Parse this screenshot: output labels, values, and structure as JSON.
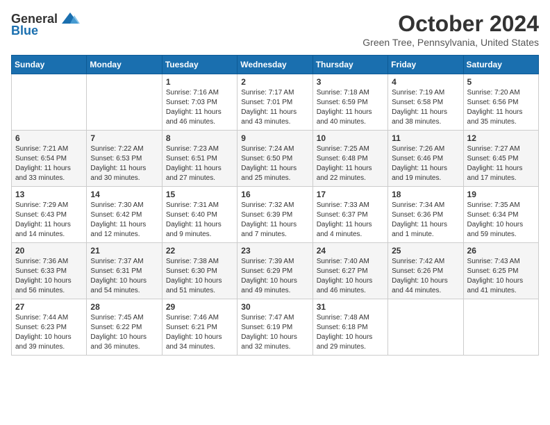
{
  "header": {
    "logo_general": "General",
    "logo_blue": "Blue",
    "month": "October 2024",
    "location": "Green Tree, Pennsylvania, United States"
  },
  "days_of_week": [
    "Sunday",
    "Monday",
    "Tuesday",
    "Wednesday",
    "Thursday",
    "Friday",
    "Saturday"
  ],
  "weeks": [
    [
      {
        "day": "",
        "info": ""
      },
      {
        "day": "",
        "info": ""
      },
      {
        "day": "1",
        "info": "Sunrise: 7:16 AM\nSunset: 7:03 PM\nDaylight: 11 hours and 46 minutes."
      },
      {
        "day": "2",
        "info": "Sunrise: 7:17 AM\nSunset: 7:01 PM\nDaylight: 11 hours and 43 minutes."
      },
      {
        "day": "3",
        "info": "Sunrise: 7:18 AM\nSunset: 6:59 PM\nDaylight: 11 hours and 40 minutes."
      },
      {
        "day": "4",
        "info": "Sunrise: 7:19 AM\nSunset: 6:58 PM\nDaylight: 11 hours and 38 minutes."
      },
      {
        "day": "5",
        "info": "Sunrise: 7:20 AM\nSunset: 6:56 PM\nDaylight: 11 hours and 35 minutes."
      }
    ],
    [
      {
        "day": "6",
        "info": "Sunrise: 7:21 AM\nSunset: 6:54 PM\nDaylight: 11 hours and 33 minutes."
      },
      {
        "day": "7",
        "info": "Sunrise: 7:22 AM\nSunset: 6:53 PM\nDaylight: 11 hours and 30 minutes."
      },
      {
        "day": "8",
        "info": "Sunrise: 7:23 AM\nSunset: 6:51 PM\nDaylight: 11 hours and 27 minutes."
      },
      {
        "day": "9",
        "info": "Sunrise: 7:24 AM\nSunset: 6:50 PM\nDaylight: 11 hours and 25 minutes."
      },
      {
        "day": "10",
        "info": "Sunrise: 7:25 AM\nSunset: 6:48 PM\nDaylight: 11 hours and 22 minutes."
      },
      {
        "day": "11",
        "info": "Sunrise: 7:26 AM\nSunset: 6:46 PM\nDaylight: 11 hours and 19 minutes."
      },
      {
        "day": "12",
        "info": "Sunrise: 7:27 AM\nSunset: 6:45 PM\nDaylight: 11 hours and 17 minutes."
      }
    ],
    [
      {
        "day": "13",
        "info": "Sunrise: 7:29 AM\nSunset: 6:43 PM\nDaylight: 11 hours and 14 minutes."
      },
      {
        "day": "14",
        "info": "Sunrise: 7:30 AM\nSunset: 6:42 PM\nDaylight: 11 hours and 12 minutes."
      },
      {
        "day": "15",
        "info": "Sunrise: 7:31 AM\nSunset: 6:40 PM\nDaylight: 11 hours and 9 minutes."
      },
      {
        "day": "16",
        "info": "Sunrise: 7:32 AM\nSunset: 6:39 PM\nDaylight: 11 hours and 7 minutes."
      },
      {
        "day": "17",
        "info": "Sunrise: 7:33 AM\nSunset: 6:37 PM\nDaylight: 11 hours and 4 minutes."
      },
      {
        "day": "18",
        "info": "Sunrise: 7:34 AM\nSunset: 6:36 PM\nDaylight: 11 hours and 1 minute."
      },
      {
        "day": "19",
        "info": "Sunrise: 7:35 AM\nSunset: 6:34 PM\nDaylight: 10 hours and 59 minutes."
      }
    ],
    [
      {
        "day": "20",
        "info": "Sunrise: 7:36 AM\nSunset: 6:33 PM\nDaylight: 10 hours and 56 minutes."
      },
      {
        "day": "21",
        "info": "Sunrise: 7:37 AM\nSunset: 6:31 PM\nDaylight: 10 hours and 54 minutes."
      },
      {
        "day": "22",
        "info": "Sunrise: 7:38 AM\nSunset: 6:30 PM\nDaylight: 10 hours and 51 minutes."
      },
      {
        "day": "23",
        "info": "Sunrise: 7:39 AM\nSunset: 6:29 PM\nDaylight: 10 hours and 49 minutes."
      },
      {
        "day": "24",
        "info": "Sunrise: 7:40 AM\nSunset: 6:27 PM\nDaylight: 10 hours and 46 minutes."
      },
      {
        "day": "25",
        "info": "Sunrise: 7:42 AM\nSunset: 6:26 PM\nDaylight: 10 hours and 44 minutes."
      },
      {
        "day": "26",
        "info": "Sunrise: 7:43 AM\nSunset: 6:25 PM\nDaylight: 10 hours and 41 minutes."
      }
    ],
    [
      {
        "day": "27",
        "info": "Sunrise: 7:44 AM\nSunset: 6:23 PM\nDaylight: 10 hours and 39 minutes."
      },
      {
        "day": "28",
        "info": "Sunrise: 7:45 AM\nSunset: 6:22 PM\nDaylight: 10 hours and 36 minutes."
      },
      {
        "day": "29",
        "info": "Sunrise: 7:46 AM\nSunset: 6:21 PM\nDaylight: 10 hours and 34 minutes."
      },
      {
        "day": "30",
        "info": "Sunrise: 7:47 AM\nSunset: 6:19 PM\nDaylight: 10 hours and 32 minutes."
      },
      {
        "day": "31",
        "info": "Sunrise: 7:48 AM\nSunset: 6:18 PM\nDaylight: 10 hours and 29 minutes."
      },
      {
        "day": "",
        "info": ""
      },
      {
        "day": "",
        "info": ""
      }
    ]
  ]
}
